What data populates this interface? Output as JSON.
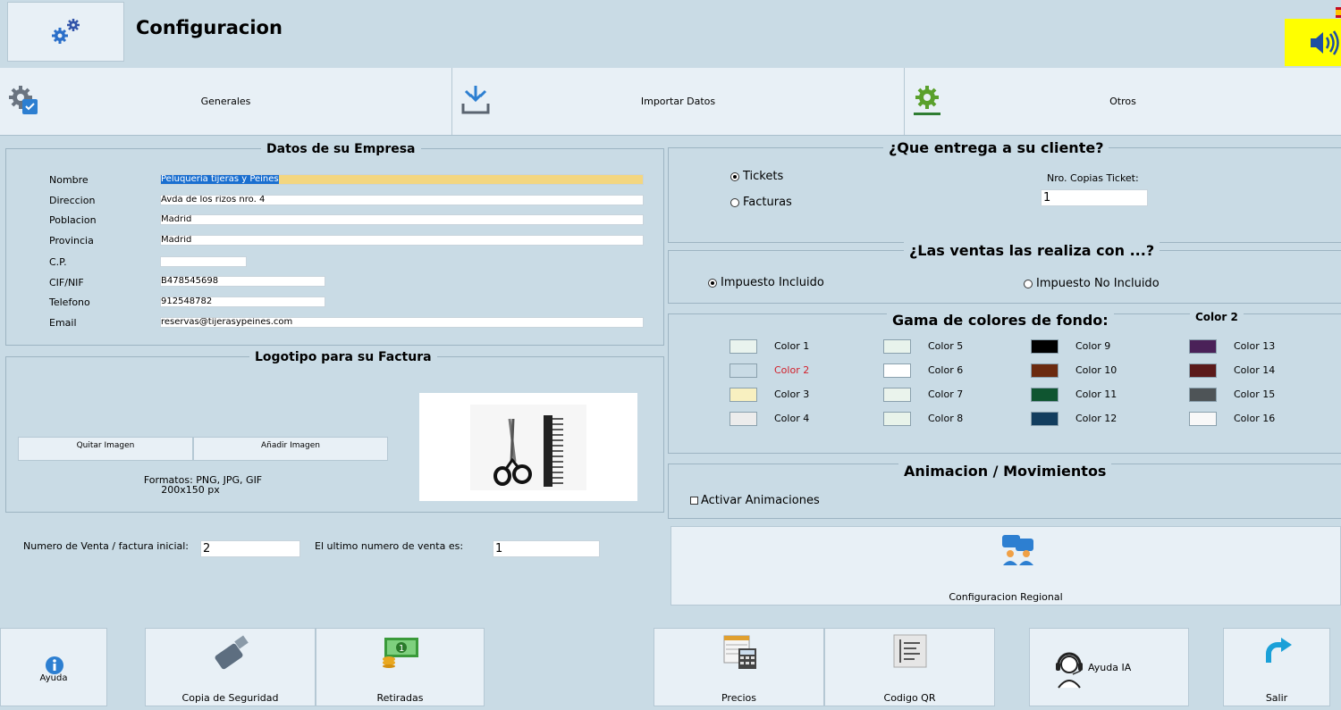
{
  "window": {
    "title": "Configuracion"
  },
  "tabs": [
    {
      "label": "Generales",
      "icon": "gear-check-icon"
    },
    {
      "label": "Importar Datos",
      "icon": "import-icon"
    },
    {
      "label": "Otros",
      "icon": "gear-icon"
    }
  ],
  "empresa": {
    "title": "Datos de su Empresa",
    "fields": {
      "nombre": {
        "label": "Nombre",
        "value": "Peluquería tijeras y Peines"
      },
      "direccion": {
        "label": "Direccion",
        "value": "Avda de los rizos nro. 4"
      },
      "poblacion": {
        "label": "Poblacion",
        "value": "Madrid"
      },
      "provincia": {
        "label": "Provincia",
        "value": "Madrid"
      },
      "cp": {
        "label": "C.P.",
        "value": ""
      },
      "cif": {
        "label": "CIF/NIF",
        "value": "B478545698"
      },
      "telefono": {
        "label": "Telefono",
        "value": "912548782"
      },
      "email": {
        "label": "Email",
        "value": "reservas@tijerasypeines.com"
      }
    }
  },
  "logo": {
    "title": "Logotipo para su Factura",
    "remove_label": "Quitar Imagen",
    "add_label": "Añadir Imagen",
    "formats": "Formatos: PNG, JPG, GIF",
    "size": "200x150 px"
  },
  "numeracion": {
    "inicial_label": "Numero de Venta / factura inicial:",
    "inicial_value": "2",
    "ultimo_label": "El ultimo numero de venta es:",
    "ultimo_value": "1"
  },
  "entrega": {
    "title": "¿Que entrega a su cliente?",
    "options": [
      "Tickets",
      "Facturas"
    ],
    "selected": "Tickets",
    "copias_label": "Nro. Copias Ticket:",
    "copias_value": "1"
  },
  "ventas": {
    "title": "¿Las ventas las realiza con ...?",
    "options": [
      "Impuesto Incluido",
      "Impuesto No Incluido"
    ],
    "selected": "Impuesto Incluido"
  },
  "colores": {
    "title": "Gama de colores de fondo:",
    "current": "Color 2",
    "selected_color": "#d21f2a",
    "items": [
      {
        "label": "Color 1",
        "color": "#e9f3ee"
      },
      {
        "label": "Color 2",
        "color": "#c9dbe5"
      },
      {
        "label": "Color 3",
        "color": "#f8f0c0"
      },
      {
        "label": "Color 4",
        "color": "#ececec"
      },
      {
        "label": "Color 5",
        "color": "#e8f3ec"
      },
      {
        "label": "Color 6",
        "color": "#ffffff"
      },
      {
        "label": "Color 7",
        "color": "#eaf3ec"
      },
      {
        "label": "Color 8",
        "color": "#e8f3ea"
      },
      {
        "label": "Color 9",
        "color": "#000000"
      },
      {
        "label": "Color 10",
        "color": "#6b2a0f"
      },
      {
        "label": "Color 11",
        "color": "#0f5530"
      },
      {
        "label": "Color 12",
        "color": "#123d5e"
      },
      {
        "label": "Color 13",
        "color": "#4a2158"
      },
      {
        "label": "Color 14",
        "color": "#5b1a1a"
      },
      {
        "label": "Color 15",
        "color": "#4e5457"
      },
      {
        "label": "Color 16",
        "color": "#f8f8f8"
      }
    ]
  },
  "animacion": {
    "title": "Animacion / Movimientos",
    "checkbox_label": "Activar Animaciones",
    "checked": false
  },
  "regional": {
    "label": "Configuracion Regional"
  },
  "footer": {
    "ayuda": "Ayuda",
    "copia": "Copia de Seguridad",
    "retiradas": "Retiradas",
    "precios": "Precios",
    "qr": "Codigo QR",
    "ayuda_ia": "Ayuda IA",
    "salir": "Salir"
  }
}
